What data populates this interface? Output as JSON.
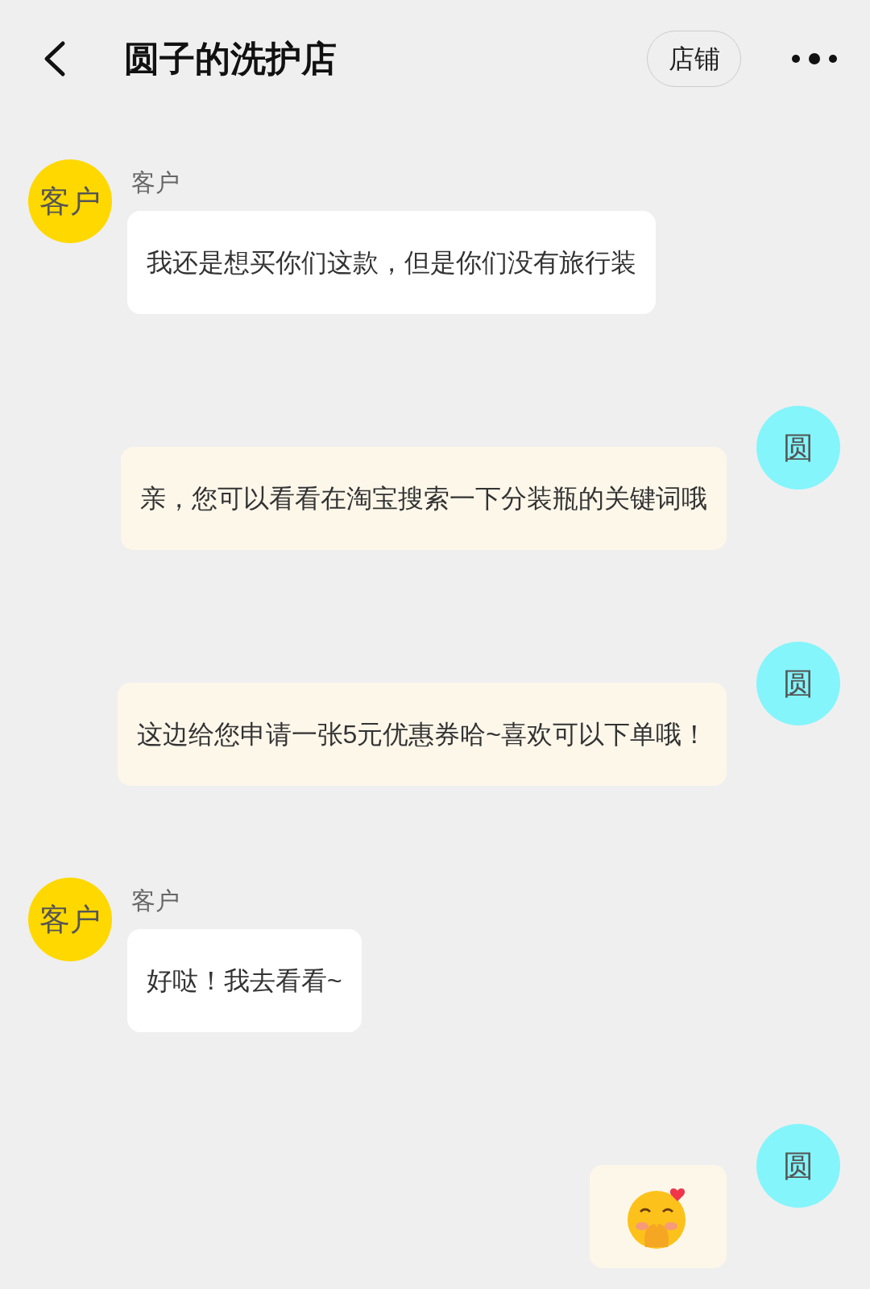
{
  "header": {
    "title": "圆子的洗护店",
    "store_button": "店铺"
  },
  "messages": [
    {
      "outgoing": false,
      "avatar": "客户",
      "name": "客户",
      "kind": "text",
      "text": "我还是想买你们这款，但是你们没有旅行装"
    },
    {
      "outgoing": true,
      "avatar": "圆",
      "kind": "text",
      "text": "亲，您可以看看在淘宝搜索一下分装瓶的关键词哦"
    },
    {
      "outgoing": true,
      "avatar": "圆",
      "kind": "text",
      "text": "这边给您申请一张5元优惠券哈~喜欢可以下单哦！"
    },
    {
      "outgoing": false,
      "avatar": "客户",
      "name": "客户",
      "kind": "text",
      "text": "好哒！我去看看~"
    },
    {
      "outgoing": true,
      "avatar": "圆",
      "kind": "sticker"
    }
  ]
}
